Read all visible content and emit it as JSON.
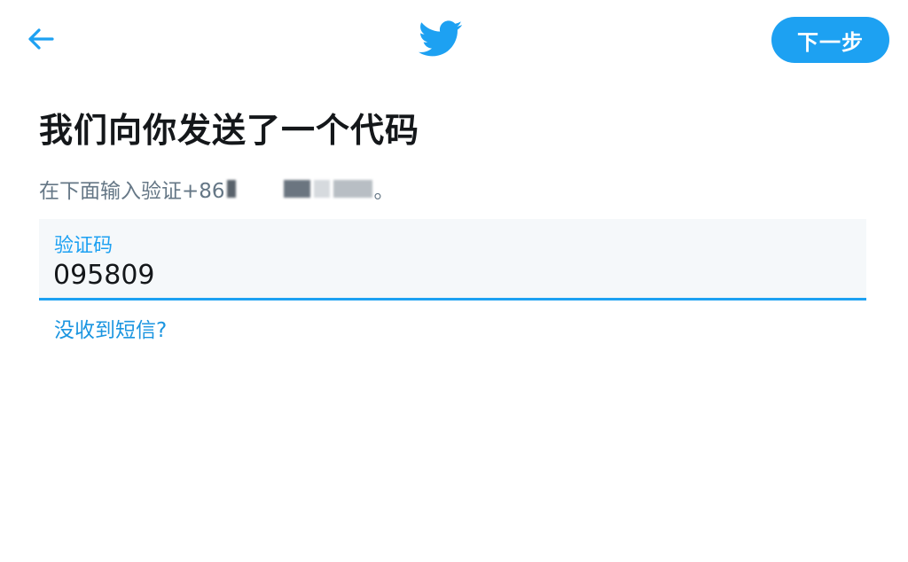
{
  "header": {
    "back_icon": "arrow-left-icon",
    "logo_icon": "twitter-bird-icon",
    "next_label": "下一步"
  },
  "main": {
    "title": "我们向你发送了一个代码",
    "subtitle_prefix": "在下面输入验证+86",
    "subtitle_suffix": "。",
    "field_label": "验证码",
    "code_value": "095809",
    "resend_link": "没收到短信?"
  },
  "colors": {
    "accent": "#1da1f2",
    "title": "#14171a",
    "muted": "#657786",
    "field_bg": "#f5f8fa"
  }
}
